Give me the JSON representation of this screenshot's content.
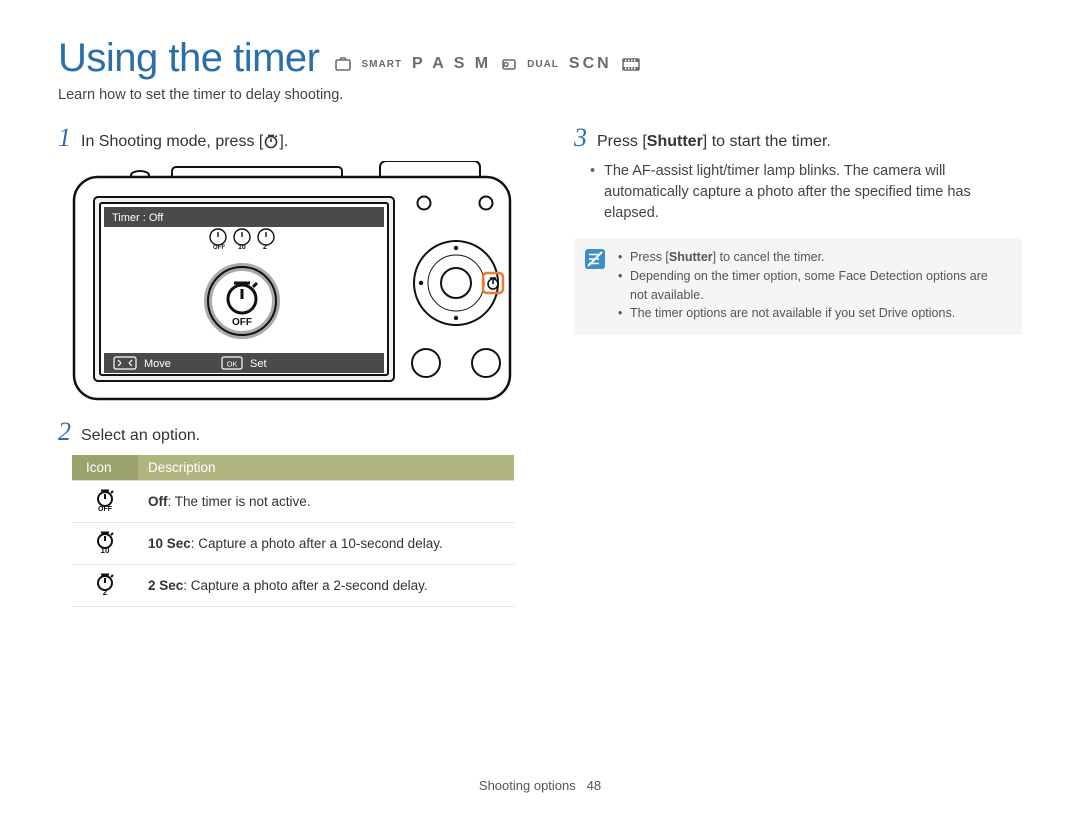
{
  "title": "Using the timer",
  "modes": {
    "smart_small": "SMART",
    "pasm": "P A S M",
    "dual_small": "DUAL",
    "scn": "SCN"
  },
  "subtitle": "Learn how to set the timer to delay shooting.",
  "left": {
    "step1_num": "1",
    "step1_text_pre": "In Shooting mode, press [",
    "step1_text_post": "].",
    "camera_screen": {
      "header": "Timer : Off",
      "bottom_move": "Move",
      "bottom_set": "Set"
    },
    "step2_num": "2",
    "step2_text": "Select an option.",
    "table": {
      "col1": "Icon",
      "col2": "Description",
      "rows": [
        {
          "icon": "off",
          "bold": "Off",
          "rest": ": The timer is not active."
        },
        {
          "icon": "10",
          "bold": "10 Sec",
          "rest": ": Capture a photo after a 10-second delay."
        },
        {
          "icon": "2",
          "bold": "2 Sec",
          "rest": ": Capture a photo after a 2-second delay."
        }
      ]
    }
  },
  "right": {
    "step3_num": "3",
    "step3_pre": "Press [",
    "step3_bold": "Shutter",
    "step3_post": "] to start the timer.",
    "bullet1": "The AF-assist light/timer lamp blinks. The camera will automatically capture a photo after the specified time has elapsed.",
    "notes": {
      "n1_pre": "Press [",
      "n1_bold": "Shutter",
      "n1_post": "] to cancel the timer.",
      "n2": "Depending on the timer option, some Face Detection options are not available.",
      "n3": "The timer options are not available if you set Drive options."
    }
  },
  "footer": {
    "section": "Shooting options",
    "page": "48"
  }
}
